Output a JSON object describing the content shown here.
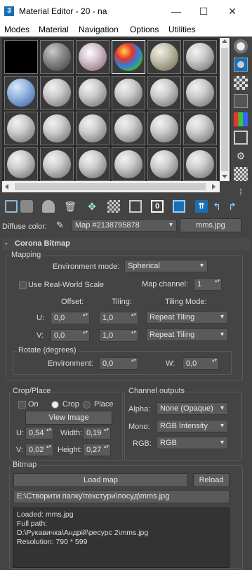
{
  "window": {
    "title": "Material Editor - 20 - na",
    "app_icon_text": "3",
    "minimize": "—",
    "maximize": "☐",
    "close": "✕"
  },
  "menubar": {
    "items": [
      "Modes",
      "Material",
      "Navigation",
      "Options",
      "Utilities"
    ]
  },
  "diffuse": {
    "label": "Diffuse color:",
    "map_name": "Map #2138795878",
    "map_file_button": "mms.jpg"
  },
  "rollout": {
    "title": "Corona Bitmap",
    "toggle": "-"
  },
  "mapping": {
    "group_title": "Mapping",
    "env_mode_label": "Environment mode:",
    "env_mode_value": "Spherical",
    "real_world_label": "Use Real-World Scale",
    "map_channel_label": "Map channel:",
    "map_channel_value": "1",
    "offset_header": "Offset:",
    "tiling_header": "Tiling:",
    "tiling_mode_header": "Tiling Mode:",
    "u_label": "U:",
    "v_label": "V:",
    "u_offset": "0,0",
    "u_tiling": "1,0",
    "u_mode": "Repeat Tiling",
    "v_offset": "0,0",
    "v_tiling": "1,0",
    "v_mode": "Repeat Tiling",
    "rotate_title": "Rotate (degrees)",
    "env_label": "Environment:",
    "env_value": "0,0",
    "w_label": "W:",
    "w_value": "0,0"
  },
  "crop": {
    "group_title": "Crop/Place",
    "on_label": "On",
    "crop_label": "Crop",
    "place_label": "Place",
    "view_image": "View Image",
    "u_label": "U:",
    "u_value": "0,54",
    "width_label": "Width:",
    "width_value": "0,19",
    "v_label": "V:",
    "v_value": "0,02",
    "height_label": "Height:",
    "height_value": "0,27"
  },
  "channel": {
    "group_title": "Channel outputs",
    "alpha_label": "Alpha:",
    "alpha_value": "None (Opaque)",
    "mono_label": "Mono:",
    "mono_value": "RGB Intensity",
    "rgb_label": "RGB:",
    "rgb_value": "RGB"
  },
  "bitmap": {
    "group_title": "Bitmap",
    "load_map": "Load map",
    "reload": "Reload",
    "path": "E:\\Створити папку\\текстури\\посуд\\mms.jpg",
    "info_loaded": "Loaded: mms.jpg",
    "info_full_path_label": "Full path:",
    "info_full_path": "D:\\Рукавичка\\Андрій\\ресурс 2\\mms.jpg",
    "info_resolution": "Resolution: 790 * 599"
  },
  "colors": {
    "accent": "#1a6fb5",
    "panel": "#444444",
    "field": "#5a5a5a"
  }
}
